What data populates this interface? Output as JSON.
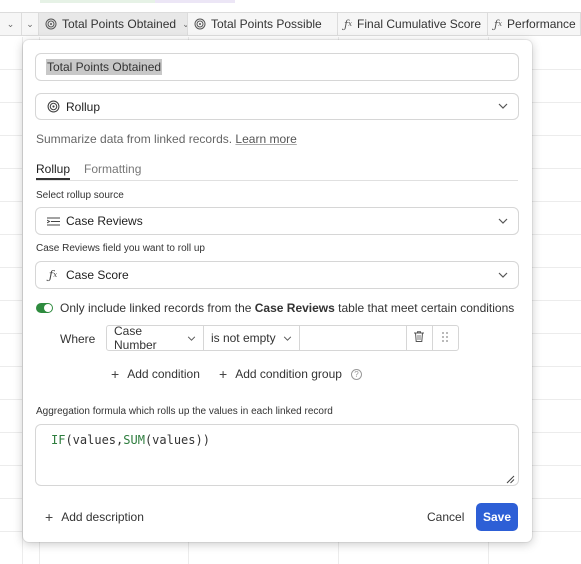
{
  "grid_header": {
    "columns": [
      {
        "label": "Total Points Obtained",
        "icon": "rollup-icon"
      },
      {
        "label": "Total Points Possible",
        "icon": "rollup-icon"
      },
      {
        "label": "Final Cumulative Score",
        "icon": "formula-icon"
      },
      {
        "label": "Performance R",
        "icon": "formula-icon"
      }
    ]
  },
  "dialog": {
    "field_name": "Total Points Obtained",
    "field_type": "Rollup",
    "description_text": "Summarize data from linked records.",
    "learn_more": "Learn more",
    "tabs": [
      {
        "label": "Rollup",
        "active": true
      },
      {
        "label": "Formatting",
        "active": false
      }
    ],
    "rollup_source_label": "Select rollup source",
    "rollup_source_value": "Case Reviews",
    "rollup_field_label": "Case Reviews field you want to roll up",
    "rollup_field_value": "Case Score",
    "condition_toggle": {
      "enabled": true,
      "prefix": "Only include linked records from the",
      "table": "Case Reviews",
      "suffix": "table that meet certain conditions"
    },
    "condition": {
      "where": "Where",
      "field": "Case Number",
      "operator": "is not empty",
      "value": ""
    },
    "add_condition": "Add condition",
    "add_condition_group": "Add condition group",
    "aggregation_label": "Aggregation formula which rolls up the values in each linked record",
    "formula": {
      "part1": "IF",
      "part2": "(values,",
      "part3": "SUM",
      "part4": "(values))"
    },
    "add_description": "Add description",
    "cancel": "Cancel",
    "save": "Save"
  },
  "colors": {
    "save_button": "#2d5fd6",
    "toggle_on": "#2e8b3e",
    "formula_function": "#2e7d3e"
  }
}
